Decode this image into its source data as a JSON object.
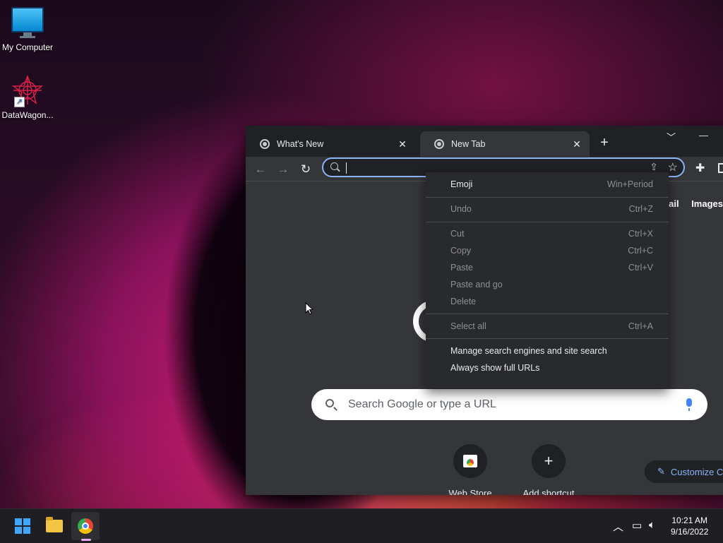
{
  "desktop": {
    "icons": [
      {
        "label": "My Computer",
        "icon": "monitor-icon"
      },
      {
        "label": "DataWagon...",
        "icon": "datawagon-logo-icon"
      }
    ]
  },
  "browser": {
    "tabs": [
      {
        "label": "What's New",
        "active": false,
        "close": "✕"
      },
      {
        "label": "New Tab",
        "active": true,
        "close": "✕"
      }
    ],
    "new_tab_glyph": "+",
    "omnibox": {
      "value": "",
      "placeholder": ""
    },
    "content": {
      "top_links": [
        "mail",
        "Images"
      ],
      "search_placeholder": "Search Google or type a URL",
      "shortcuts": [
        {
          "label": "Web Store",
          "icon": "web-store-icon"
        },
        {
          "label": "Add shortcut",
          "icon": "plus-icon",
          "glyph": "+"
        }
      ],
      "customize_label": "Customize C"
    }
  },
  "context_menu": {
    "groups": [
      [
        {
          "label": "Emoji",
          "shortcut": "Win+Period",
          "enabled": true
        }
      ],
      [
        {
          "label": "Undo",
          "shortcut": "Ctrl+Z",
          "enabled": false
        }
      ],
      [
        {
          "label": "Cut",
          "shortcut": "Ctrl+X",
          "enabled": false
        },
        {
          "label": "Copy",
          "shortcut": "Ctrl+C",
          "enabled": false
        },
        {
          "label": "Paste",
          "shortcut": "Ctrl+V",
          "enabled": false
        },
        {
          "label": "Paste and go",
          "shortcut": "",
          "enabled": false
        },
        {
          "label": "Delete",
          "shortcut": "",
          "enabled": false
        }
      ],
      [
        {
          "label": "Select all",
          "shortcut": "Ctrl+A",
          "enabled": false
        }
      ],
      [
        {
          "label": "Manage search engines and site search",
          "shortcut": "",
          "enabled": true
        },
        {
          "label": "Always show full URLs",
          "shortcut": "",
          "enabled": true
        }
      ]
    ]
  },
  "taskbar": {
    "apps": [
      {
        "name": "start",
        "icon": "windows-logo-icon"
      },
      {
        "name": "file-explorer",
        "icon": "folder-icon"
      },
      {
        "name": "chrome",
        "icon": "chrome-icon",
        "active": true
      }
    ],
    "clock": {
      "time": "10:21 AM",
      "date": "9/16/2022"
    }
  }
}
